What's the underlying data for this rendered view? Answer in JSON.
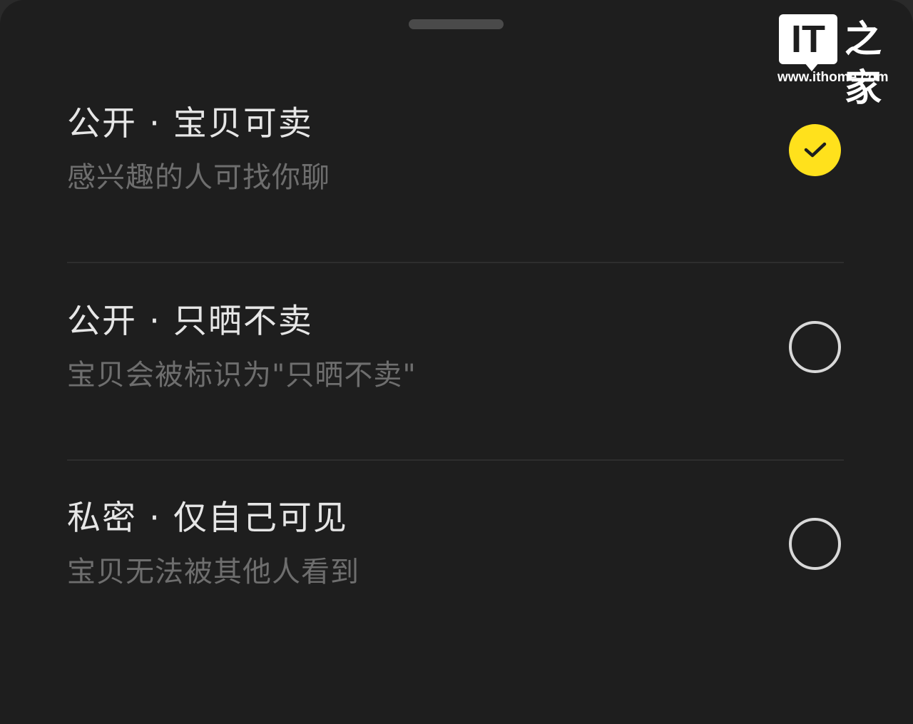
{
  "watermark": {
    "logo_text": "IT",
    "logo_glyph": "之家",
    "url": "www.ithome.com"
  },
  "options": [
    {
      "title": "公开 · 宝贝可卖",
      "subtitle": "感兴趣的人可找你聊",
      "selected": true
    },
    {
      "title": "公开 · 只晒不卖",
      "subtitle": "宝贝会被标识为\"只晒不卖\"",
      "selected": false
    },
    {
      "title": "私密 · 仅自己可见",
      "subtitle": "宝贝无法被其他人看到",
      "selected": false
    }
  ],
  "colors": {
    "background": "#1e1e1e",
    "accent": "#ffe11c",
    "title_text": "#e6e6e6",
    "subtitle_text": "#6e6e6e"
  }
}
